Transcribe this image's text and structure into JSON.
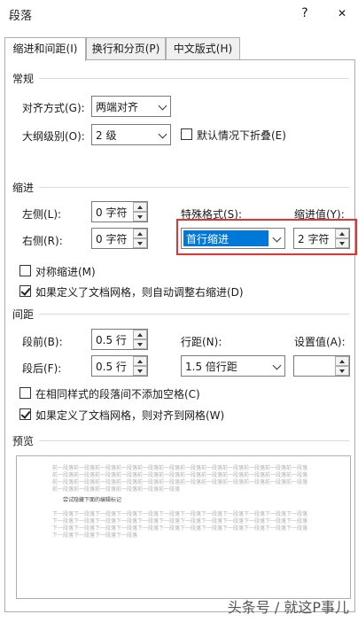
{
  "window": {
    "title": "段落",
    "help": "?",
    "close": "✕"
  },
  "tabs": [
    {
      "label": "缩进和间距(I)"
    },
    {
      "label": "换行和分页(P)"
    },
    {
      "label": "中文版式(H)"
    }
  ],
  "general": {
    "heading": "常规",
    "alignment_label": "对齐方式(G):",
    "alignment_value": "两端对齐",
    "outline_label": "大纲级别(O):",
    "outline_value": "2 级",
    "collapse_label": "默认情况下折叠(E)"
  },
  "indent": {
    "heading": "缩进",
    "left_label": "左侧(L):",
    "left_value": "0 字符",
    "right_label": "右侧(R):",
    "right_value": "0 字符",
    "special_label": "特殊格式(S):",
    "special_value": "首行缩进",
    "by_label": "缩进值(Y):",
    "by_value": "2 字符",
    "mirror_label": "对称缩进(M)",
    "auto_adjust_label": "如果定义了文档网格，则自动调整右缩进(D)"
  },
  "spacing": {
    "heading": "间距",
    "before_label": "段前(B):",
    "before_value": "0.5 行",
    "after_label": "段后(F):",
    "after_value": "0.5 行",
    "line_label": "行距(N):",
    "line_value": "1.5 倍行距",
    "at_label": "设置值(A):",
    "at_value": "",
    "no_space_label": "在相同样式的段落间不添加空格(C)",
    "snap_grid_label": "如果定义了文档网格，则对齐到网格(W)"
  },
  "preview": {
    "heading": "预览",
    "prev_lines": [
      "前一段落前一段落前一段落前一段落前一段落前一段落前一段落前一段落前一段落前一段落前一段落前一段落",
      "前一段落前一段落前一段落前一段落前一段落前一段落前一段落前一段落前一段落前一段落前一段落前一段落",
      "前一段落前一段落前一段落前一段落前一段落前一段落前一段落前一段落前一段落前一段落前一段落前一段落",
      "前一段落前一段落前一段落前一段落前一段落前一段落"
    ],
    "sample_text": "尝试隐藏下面的编辑标记",
    "next_lines": [
      "下一段落下一段落下一段落下一段落下一段落下一段落下一段落下一段落下一段落下一段落下一段落下一段落",
      "下一段落下一段落下一段落下一段落下一段落下一段落下一段落下一段落下一段落下一段落下一段落下一段落",
      "下一段落下一段落下一段落下一段落下一段落下一段落下一段落下一段落下一段落下一段落下一段落下一段落",
      "下一段落下一段落下一段落下一段落"
    ]
  },
  "watermark": "头条号 / 就这P事儿",
  "colors": {
    "highlight": "#e8322b",
    "selection": "#0078d7"
  }
}
